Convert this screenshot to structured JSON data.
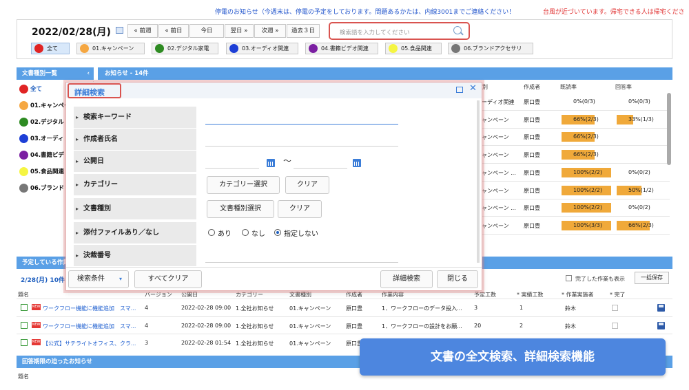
{
  "ticker": {
    "main": "停電のお知らせ（今週末は、停電の予定をしております。問題あるかたは、内線3001までご連絡ください！",
    "alert": "台風が近づいています。帰宅できる人は帰宅くださ"
  },
  "header": {
    "date": "2022/02/28(月)",
    "nav": [
      "« 前週",
      "« 前日",
      "今日",
      "翌日 »",
      "次週 »",
      "過去３日"
    ],
    "search_placeholder": "検索語を入力してください"
  },
  "categories": [
    {
      "label": "全て",
      "color": "#e02424"
    },
    {
      "label": "01.キャンペーン",
      "color": "#f5a742"
    },
    {
      "label": "02.デジタル家電",
      "color": "#2e8b22"
    },
    {
      "label": "03.オーディオ関連",
      "color": "#1d3fd6"
    },
    {
      "label": "04.書籍ビデオ関連",
      "color": "#7b1fa2"
    },
    {
      "label": "05.食品関連",
      "color": "#f5f542"
    },
    {
      "label": "06.ブランドアクセサリ",
      "color": "#777777"
    }
  ],
  "left_panel": {
    "title": "文書種別一覧",
    "collapse": "‹",
    "items": [
      "全て",
      "01.キャンペー",
      "02.デジタル",
      "03.オーディ",
      "04.書籍ビデ",
      "05.食品関連",
      "06.ブランド"
    ]
  },
  "notices": {
    "title": "お知らせ - 14件",
    "columns": {
      "kind": "別",
      "author": "作成者",
      "read": "既読率",
      "answer": "回答率"
    },
    "rows": [
      {
        "kind": "ーディオ関連",
        "author": "原口豊",
        "read": "0%(0/3)",
        "read_pct": 0,
        "answer": "0%(0/3)",
        "answer_pct": 0
      },
      {
        "kind": "ャンペーン",
        "author": "原口豊",
        "read": "66%(2/3)",
        "read_pct": 66,
        "answer": "33%(1/3)",
        "answer_pct": 33
      },
      {
        "kind": "ャンペーン",
        "author": "原口豊",
        "read": "66%(2/3)",
        "read_pct": 66,
        "answer": "",
        "answer_pct": 0
      },
      {
        "kind": "ャンペーン",
        "author": "原口豊",
        "read": "66%(2/3)",
        "read_pct": 66,
        "answer": "",
        "answer_pct": 0
      },
      {
        "kind": "ャンペーン ...",
        "author": "原口豊",
        "read": "100%(2/2)",
        "read_pct": 100,
        "answer": "0%(0/2)",
        "answer_pct": 0
      },
      {
        "kind": "ャンペーン",
        "author": "原口豊",
        "read": "100%(2/2)",
        "read_pct": 100,
        "answer": "50%(1/2)",
        "answer_pct": 50
      },
      {
        "kind": "ャンペーン ...",
        "author": "原口豊",
        "read": "100%(2/2)",
        "read_pct": 100,
        "answer": "0%(0/2)",
        "answer_pct": 0
      },
      {
        "kind": "ャンペーン",
        "author": "原口豊",
        "read": "100%(3/3)",
        "read_pct": 100,
        "answer": "66%(2/3)",
        "answer_pct": 66
      }
    ]
  },
  "tasks": {
    "title": "予定している作業",
    "day": "2/28(月) 10件",
    "show_done": "完了した作業も表示",
    "save_all": "一括保存",
    "columns": [
      "題名",
      "バージョン",
      "公開日",
      "カテゴリー",
      "文書種別",
      "作成者",
      "作業内容",
      "予定工数",
      "* 実績工数",
      "* 作業実施者",
      "* 完了"
    ],
    "rows": [
      {
        "title": "ワークフロー機能に機能追加　スマ...",
        "version": "4",
        "date": "2022-02-28 09:00",
        "category": "1.全社お知らせ",
        "type": "01.キャンペーン",
        "author": "原口豊",
        "work": "1．ワークフローのデータ投入...",
        "plan": "3",
        "actual": "1",
        "worker": "鈴木"
      },
      {
        "title": "ワークフロー機能に機能追加　スマ...",
        "version": "4",
        "date": "2022-02-28 09:00",
        "category": "1.全社お知らせ",
        "type": "01.キャンペーン",
        "author": "原口豊",
        "work": "1．ワークフローの設計をお願...",
        "plan": "20",
        "actual": "2",
        "worker": "鈴木"
      },
      {
        "title": "【公式】サテライトオフィス、クラ...",
        "version": "3",
        "date": "2022-02-28 01:54",
        "category": "1.全社お知らせ",
        "type": "01.キャンペーン",
        "author": "原口豊",
        "work": "",
        "plan": "",
        "actual": "",
        "worker": ""
      }
    ]
  },
  "deadline": {
    "title": "回答期限の迫ったお知らせ",
    "subject_col": "題名"
  },
  "modal": {
    "title": "詳細検索",
    "fields": [
      "検索キーワード",
      "作成者氏名",
      "公開日",
      "カテゴリー",
      "文書種別",
      "添付ファイルあり／なし",
      "決裁番号"
    ],
    "tilde": "～",
    "category_select": "カテゴリー選択",
    "type_select": "文書種別選択",
    "clear": "クリア",
    "radios": [
      "あり",
      "なし",
      "指定しない"
    ],
    "footer": {
      "conditions": "検索条件",
      "clear_all": "すべてクリア",
      "search": "詳細検索",
      "close": "閉じる"
    }
  },
  "caption": "文書の全文検索、詳細検索機能"
}
